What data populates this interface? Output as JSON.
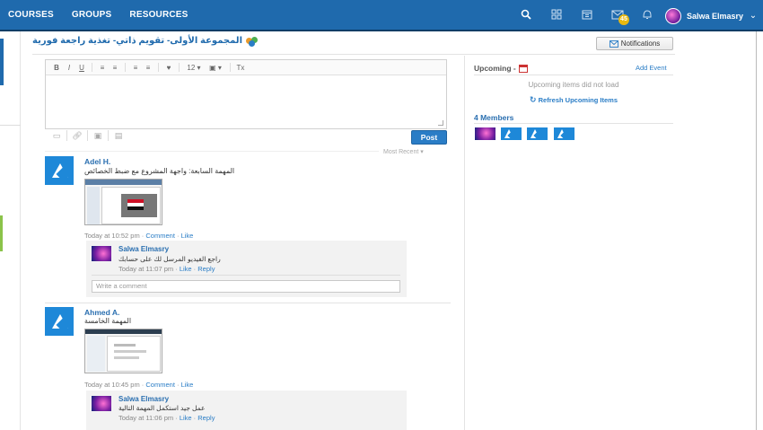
{
  "topbar": {
    "nav": [
      "COURSES",
      "GROUPS",
      "RESOURCES"
    ],
    "icons": [
      "search-icon",
      "dashboard-icon",
      "calendar-icon",
      "inbox-icon",
      "help-icon"
    ],
    "inbox_badge": "45",
    "user_name": "Salwa Elmasry",
    "colors": {
      "bar": "#1f6aad",
      "badge": "#e8b810"
    }
  },
  "page": {
    "title": "المجموعة الأولى- تقويم ذاتي- تغذية راجعة فورية",
    "notifications_label": "Notifications"
  },
  "editor": {
    "toolbar": [
      "B",
      "I",
      "U",
      "≡",
      "≡",
      "≡",
      "≡",
      "♥",
      "12 ▾",
      "▣ ▾",
      "Tx"
    ],
    "post_label": "Post",
    "sort_label": "Most Recent ▾"
  },
  "posts": [
    {
      "author": "Adel H.",
      "text": "المهمة السابعة: واجهة المشروع مع ضبط الخصائص",
      "time": "Today at 10:52 pm",
      "comment_label": "Comment",
      "like_label": "Like",
      "comments": [
        {
          "author": "Salwa Elmasry",
          "text": "راجع الفيديو المرسل لك على حسابك",
          "time": "Today at 11:07 pm",
          "like_label": "Like",
          "reply_label": "Reply"
        }
      ],
      "write_comment_placeholder": "Write a comment"
    },
    {
      "author": "Ahmed A.",
      "text": "المهمة الخامسة",
      "time": "Today at 10:45 pm",
      "comment_label": "Comment",
      "like_label": "Like",
      "comments": [
        {
          "author": "Salwa Elmasry",
          "text": "عمل جيد استكمل المهمة التالية",
          "time": "Today at 11:06 pm",
          "like_label": "Like",
          "reply_label": "Reply"
        }
      ]
    }
  ],
  "sidebar": {
    "upcoming_label": "Upcoming -",
    "add_event_label": "Add Event",
    "no_load_text": "Upcoming items did not load",
    "refresh_label": "Refresh Upcoming Items",
    "members_label": "4 Members"
  }
}
